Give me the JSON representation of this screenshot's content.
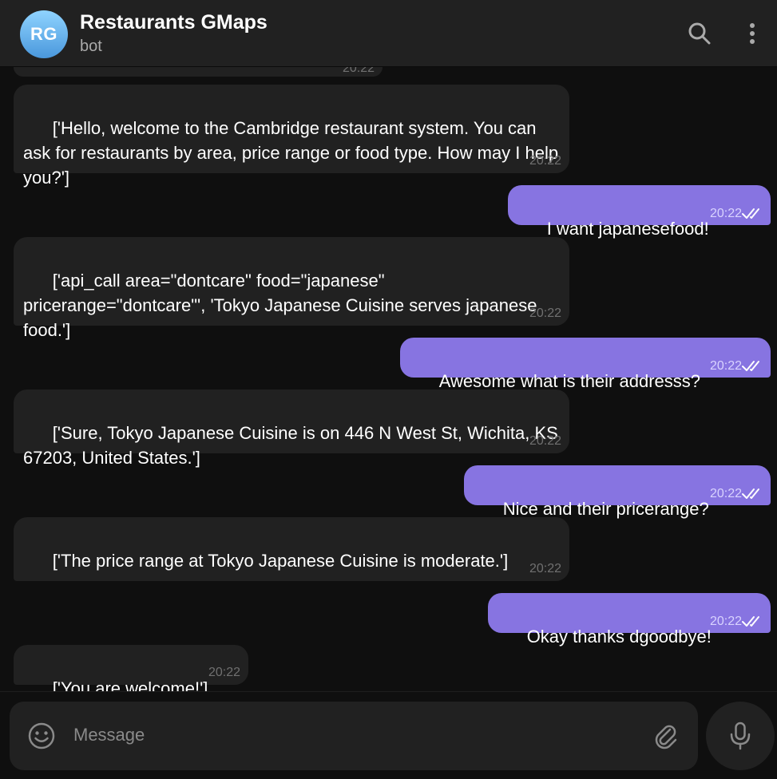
{
  "header": {
    "avatar_initials": "RG",
    "title": "Restaurants GMaps",
    "subtitle": "bot"
  },
  "peek_message": {
    "time": "20:22"
  },
  "messages": [
    {
      "dir": "in",
      "text": "['Hello, welcome to the Cambridge restaurant system. You can ask for restaurants by area, price range or food type. How may I help you?']",
      "time": "20:22"
    },
    {
      "dir": "out",
      "text": "I want japanesefood!",
      "time": "20:22"
    },
    {
      "dir": "in",
      "text": "['api_call area=\"dontcare\" food=\"japanese\" pricerange=\"dontcare\"', 'Tokyo Japanese Cuisine serves japanese food.']",
      "time": "20:22"
    },
    {
      "dir": "out",
      "text": "Awesome what is their addresss?",
      "time": "20:22"
    },
    {
      "dir": "in",
      "text": "['Sure, Tokyo Japanese Cuisine is on 446 N West St, Wichita, KS 67203, United States.']",
      "time": "20:22"
    },
    {
      "dir": "out",
      "text": "Nice and their pricerange?",
      "time": "20:22"
    },
    {
      "dir": "in",
      "text": "['The price range at Tokyo Japanese Cuisine is moderate.']",
      "time": "20:22"
    },
    {
      "dir": "out",
      "text": "Okay thanks dgoodbye!",
      "time": "20:22"
    },
    {
      "dir": "in",
      "text": "['You are welcome!']",
      "time": "20:22"
    }
  ],
  "composer": {
    "placeholder": "Message",
    "value": ""
  },
  "icons": {
    "search": "search-icon",
    "menu": "more-vertical-icon",
    "emoji": "smiley-icon",
    "attach": "paperclip-icon",
    "mic": "microphone-icon",
    "read_status": "double-check-icon"
  },
  "colors": {
    "outgoing_bubble": "#8774e1",
    "incoming_bubble": "#212121",
    "background": "#0f0f0f",
    "header": "#212121"
  }
}
